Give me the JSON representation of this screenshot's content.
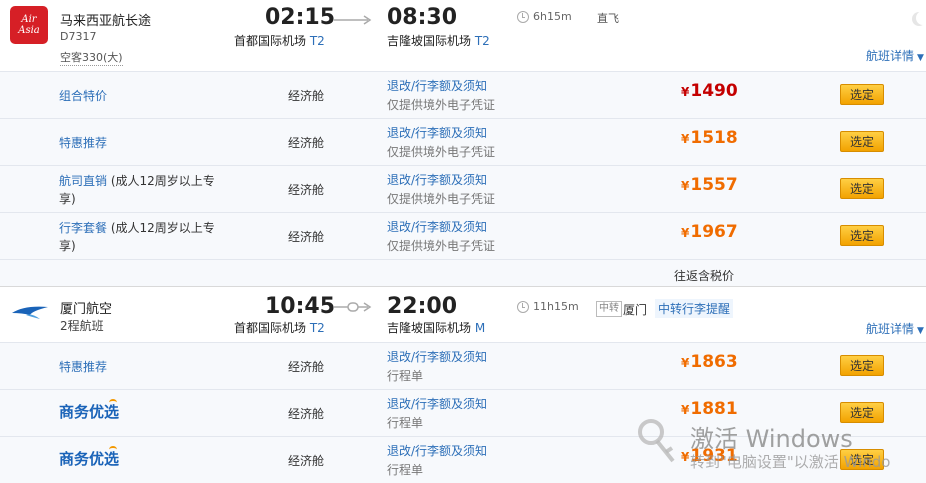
{
  "flights": [
    {
      "airline": "马来西亚航长途",
      "flight_no": "D7317",
      "aircraft": "空客330(大)",
      "dep_time": "02:15",
      "dep_airport": "首都国际机场",
      "dep_terminal": "T2",
      "arr_time": "08:30",
      "arr_airport": "吉隆坡国际机场",
      "arr_terminal": "T2",
      "duration": "6h15m",
      "nonstop": "直飞",
      "details": "航班详情",
      "logo_text": "Air Asia",
      "fares": [
        {
          "name": "组合特价",
          "sub": "",
          "cabin": "经济舱",
          "rules": "退改/行李额及须知",
          "note": "仅提供境外电子凭证",
          "yen": "¥",
          "price": "1490",
          "select": "选定"
        },
        {
          "name": "特惠推荐",
          "sub": "",
          "cabin": "经济舱",
          "rules": "退改/行李额及须知",
          "note": "仅提供境外电子凭证",
          "yen": "¥",
          "price": "1518",
          "select": "选定"
        },
        {
          "name": "航司直销",
          "sub": "(成人12周岁以上专享)",
          "cabin": "经济舱",
          "rules": "退改/行李额及须知",
          "note": "仅提供境外电子凭证",
          "yen": "¥",
          "price": "1557",
          "select": "选定"
        },
        {
          "name": "行李套餐",
          "sub": "(成人12周岁以上专享)",
          "cabin": "经济舱",
          "rules": "退改/行李额及须知",
          "note": "仅提供境外电子凭证",
          "yen": "¥",
          "price": "1967",
          "select": "选定"
        }
      ],
      "roundtrip": "往返含税价"
    },
    {
      "airline": "厦门航空",
      "flight_no": "2程航班",
      "dep_time": "10:45",
      "dep_airport": "首都国际机场",
      "dep_terminal": "T2",
      "arr_time": "22:00",
      "arr_airport": "吉隆坡国际机场",
      "arr_terminal": "M",
      "duration": "11h15m",
      "stop_tag": "中转",
      "stop_city": "厦门",
      "transfer_note": "中转行李提醒",
      "details": "航班详情",
      "fares": [
        {
          "name": "特惠推荐",
          "cabin": "经济舱",
          "rules": "退改/行李额及须知",
          "note": "行程单",
          "yen": "¥",
          "price": "1863",
          "select": "选定"
        },
        {
          "name": "商务优选",
          "cabin": "经济舱",
          "rules": "退改/行李额及须知",
          "note": "行程单",
          "yen": "¥",
          "price": "1881",
          "select": "选定"
        },
        {
          "name": "商务优选",
          "cabin": "经济舱",
          "rules": "退改/行李额及须知",
          "note": "行程单",
          "yen": "¥",
          "price": "1931",
          "select": "选定"
        }
      ]
    }
  ],
  "watermark": {
    "title": "激活 Windows",
    "subtitle": "转到\"电脑设置\"以激活 Windo"
  },
  "colors": {
    "link": "#2d6fb8",
    "price_orange": "#f06c00",
    "price_red": "#c40000",
    "button": "#f2a200",
    "airasia_red": "#d61f26",
    "xiamen_blue": "#1a63b8"
  }
}
